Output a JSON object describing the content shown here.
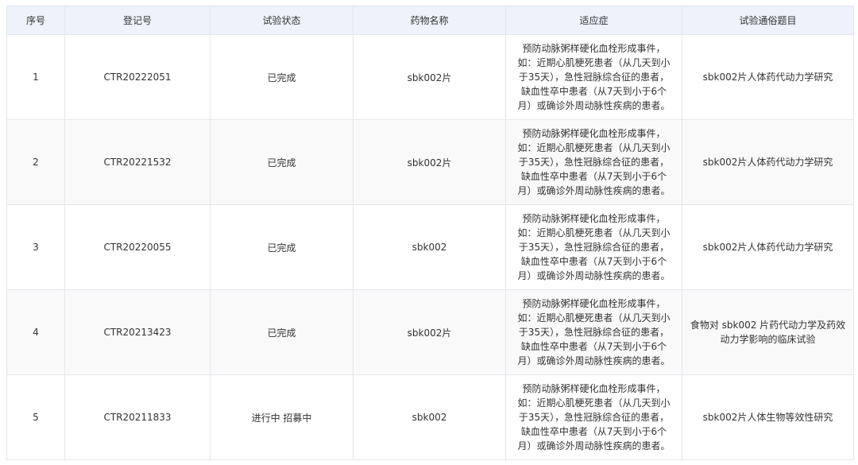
{
  "table": {
    "headers": [
      "序号",
      "登记号",
      "试验状态",
      "药物名称",
      "适应症",
      "试验通俗题目"
    ],
    "rows": [
      {
        "no": "1",
        "reg": "CTR20222051",
        "status": "已完成",
        "drug": "sbk002片",
        "indication": "预防动脉粥样硬化血栓形成事件，\n如：近期心肌梗死患者（从几天到小\n于35天），急性冠脉综合征的患者，\n缺血性卒中患者（从7天到小于6个\n月）或确诊外周动脉性疾病的患者。",
        "title": "sbk002片人体药代动力学研究"
      },
      {
        "no": "2",
        "reg": "CTR20221532",
        "status": "已完成",
        "drug": "sbk002片",
        "indication": "预防动脉粥样硬化血栓形成事件，\n如：近期心肌梗死患者（从几天到小\n于35天），急性冠脉综合征的患者，\n缺血性卒中患者（从7天到小于6个\n月）或确诊外周动脉性疾病的患者。",
        "title": "sbk002片人体药代动力学研究"
      },
      {
        "no": "3",
        "reg": "CTR20220055",
        "status": "已完成",
        "drug": "sbk002",
        "indication": "预防动脉粥样硬化血栓形成事件，\n如：近期心肌梗死患者（从几天到小\n于35天），急性冠脉综合征的患者，\n缺血性卒中患者（从7天到小于6个\n月）或确诊外周动脉性疾病的患者。",
        "title": "sbk002片人体药代动力学研究"
      },
      {
        "no": "4",
        "reg": "CTR20213423",
        "status": "已完成",
        "drug": "sbk002片",
        "indication": "预防动脉粥样硬化血栓形成事件，\n如：近期心肌梗死患者（从几天到小\n于35天），急性冠脉综合征的患者，\n缺血性卒中患者（从7天到小于6个\n月）或确诊外周动脉性疾病的患者。",
        "title": "食物对 sbk002 片药代动力学及药效动力学影响的临床试验"
      },
      {
        "no": "5",
        "reg": "CTR20211833",
        "status": "进行中 招募中",
        "drug": "sbk002",
        "indication": "预防动脉粥样硬化血栓形成事件，\n如：近期心肌梗死患者（从几天到小\n于35天），急性冠脉综合征的患者，\n缺血性卒中患者（从7天到小于6个\n月）或确诊外周动脉性疾病的患者。",
        "title": "sbk002片人体生物等效性研究"
      }
    ]
  }
}
